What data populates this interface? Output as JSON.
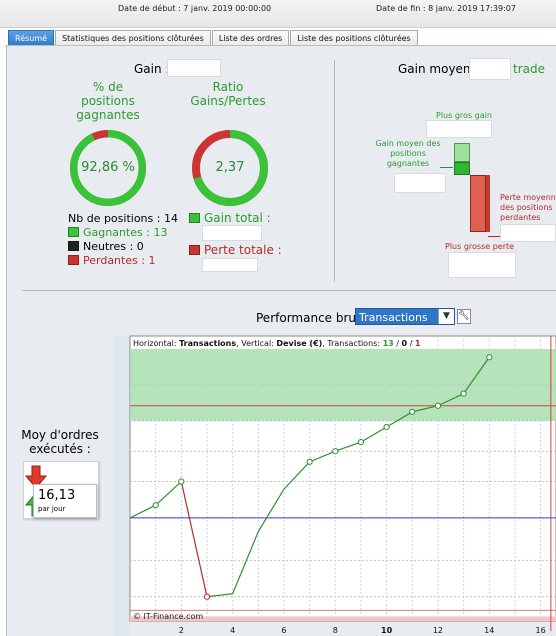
{
  "header": {
    "start_date": "Date de début : 7 janv. 2019 00:00:00",
    "end_date": "Date de fin : 8 janv. 2019 17:39:07"
  },
  "tabs": [
    {
      "label": "Résumé",
      "active": true
    },
    {
      "label": "Statistiques des positions clôturées",
      "active": false
    },
    {
      "label": "Liste des ordres",
      "active": false
    },
    {
      "label": "Liste des positions clôturées",
      "active": false
    }
  ],
  "summary": {
    "gain_label": "Gain :",
    "pct_winning_title": "% de\npositions\ngagnantes",
    "pct_winning_value": "92,86 %",
    "pct_winning_fraction": 0.9286,
    "ratio_title": "Ratio\nGains/Pertes",
    "ratio_value": "2,37",
    "ratio_fraction": 0.703,
    "nb_positions": "Nb de positions : 14",
    "winning": "Gagnantes : 13",
    "neutral": "Neutres : 0",
    "losing": "Perdantes : 1",
    "total_gain_label": "Gain total :",
    "total_loss_label": "Perte totale :"
  },
  "avg_gain": {
    "label": "Gain moyen :",
    "unit": "trade",
    "biggest_gain": "Plus gros gain",
    "avg_gain_winning": "Gain moyen des\npositions\ngagnantes",
    "avg_loss_losing": "Perte moyenne\ndes positions\nperdantes",
    "biggest_loss": "Plus grosse perte"
  },
  "performance": {
    "label": "Performance brute",
    "selected": "Transactions",
    "chart_info_prefix": "Horizontal: ",
    "chart_info_h": "Transactions",
    "chart_info_mid": ", Vertical: ",
    "chart_info_v": "Devise (€)",
    "chart_info_tx": ", Transactions: ",
    "tx_win": "13",
    "tx_sep1": " / ",
    "tx_neutral": "0",
    "tx_sep2": " / ",
    "tx_lose": "1",
    "copyright": "© IT-Finance.com"
  },
  "orders": {
    "title": "Moy d'ordres\nexécutés :",
    "value": "16,13",
    "unit": "par jour"
  },
  "colors": {
    "accent": "#2f76c6",
    "win": "#2e9a2e",
    "lose": "#b42b2b",
    "neutral": "#222222"
  },
  "chart_data": {
    "type": "line",
    "x_ticks": [
      "2",
      "4",
      "6",
      "8",
      "10",
      "12",
      "14",
      "16"
    ],
    "series": [
      {
        "x": [
          0,
          1,
          2,
          3
        ],
        "y": [
          0.0,
          0.42,
          1.2,
          -2.6
        ]
      },
      {
        "x": [
          3,
          4,
          5,
          6,
          7,
          8,
          9,
          10,
          11,
          12,
          13,
          14
        ],
        "y": [
          -2.6,
          -2.5,
          -0.45,
          0.95,
          1.85,
          2.2,
          2.5,
          3.0,
          3.5,
          3.7,
          4.1,
          5.3
        ]
      }
    ],
    "xlim": [
      0,
      16.6
    ],
    "ylim": [
      -3.4,
      6.0
    ],
    "grid": true
  }
}
